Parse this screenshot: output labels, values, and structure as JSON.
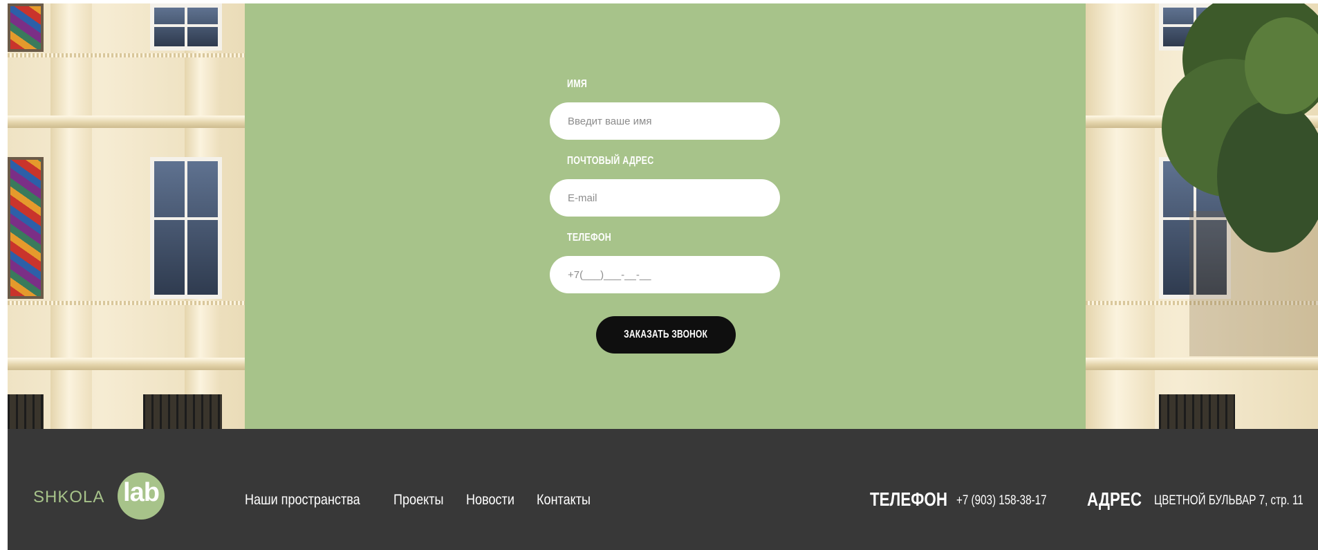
{
  "form": {
    "name_label": "ИМЯ",
    "name_placeholder": "Введит ваше имя",
    "email_label": "ПОЧТОВЫЙ АДРЕС",
    "email_placeholder": "E-mail",
    "phone_label": "ТЕЛЕФОН",
    "phone_placeholder": "+7(___)___-__-__",
    "submit_label": "ЗАКАЗАТЬ ЗВОНОК"
  },
  "footer": {
    "logo": {
      "text": "SHKOLA",
      "badge": "lab"
    },
    "nav": [
      "Наши пространства",
      "Проекты",
      "Новости",
      "Контакты"
    ],
    "phone_title": "ТЕЛЕФОН",
    "phone_value": "+7 (903) 158-38-17",
    "address_title": "АДРЕС",
    "address_value": "ЦВЕТНОЙ БУЛЬВАР 7, стр. 11"
  },
  "colors": {
    "panel_green": "#a7c38a",
    "footer_dark": "#383838",
    "button_black": "#0f0f0f",
    "white": "#ffffff"
  }
}
